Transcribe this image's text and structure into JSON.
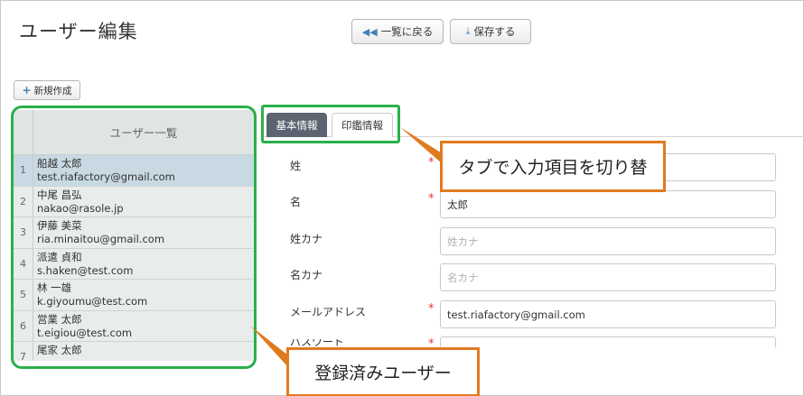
{
  "page": {
    "title": "ユーザー編集"
  },
  "toolbar": {
    "back_icon": "double-chevron-left-icon",
    "back_label": "一覧に戻る",
    "save_icon": "download-icon",
    "save_label": "保存する",
    "new_icon": "plus-icon",
    "new_label": "新規作成"
  },
  "user_list": {
    "header": "ユーザー一覧",
    "rows": [
      {
        "num": "1",
        "name": "船越 太郎",
        "email": "test.riafactory@gmail.com"
      },
      {
        "num": "2",
        "name": "中尾 昌弘",
        "email": "nakao@rasole.jp"
      },
      {
        "num": "3",
        "name": "伊藤 美菜",
        "email": "ria.minaitou@gmail.com"
      },
      {
        "num": "4",
        "name": "派遣 貞和",
        "email": "s.haken@test.com"
      },
      {
        "num": "5",
        "name": "林 一雄",
        "email": "k.giyoumu@test.com"
      },
      {
        "num": "6",
        "name": "営業 太郎",
        "email": "t.eigiou@test.com"
      },
      {
        "num": "7",
        "name": "尾家 太郎",
        "email": ""
      }
    ]
  },
  "tabs": [
    {
      "label": "基本情報"
    },
    {
      "label": "印鑑情報"
    }
  ],
  "form": {
    "last_name": {
      "label": "姓",
      "value": "",
      "placeholder": ""
    },
    "first_name": {
      "label": "名",
      "value": "太郎",
      "placeholder": ""
    },
    "last_name_kana": {
      "label": "姓カナ",
      "value": "",
      "placeholder": "姓カナ"
    },
    "first_name_kana": {
      "label": "名カナ",
      "value": "",
      "placeholder": "名カナ"
    },
    "email": {
      "label": "メールアドレス",
      "value": "test.riafactory@gmail.com",
      "placeholder": ""
    },
    "password": {
      "label": "パスワード",
      "value": "",
      "placeholder": ""
    },
    "required_mark": "*"
  },
  "callouts": {
    "tabs_note": "タブで入力項目を切り替",
    "users_note": "登録済みユーザー"
  },
  "colors": {
    "highlight_green": "#2ab04a",
    "callout_orange": "#e07a1f",
    "active_tab": "#5b6470",
    "selected_row": "#c8d9e3",
    "required_red": "#d93838"
  }
}
